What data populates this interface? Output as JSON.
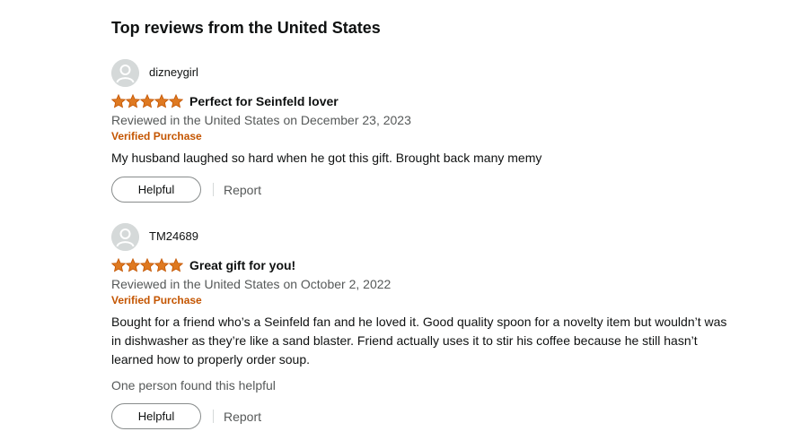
{
  "section": {
    "title": "Top reviews from the United States"
  },
  "colors": {
    "star": "#de7921",
    "verified": "#c45500",
    "muted_text": "#565959"
  },
  "reviews": [
    {
      "profile_name": "dizneygirl",
      "rating": 5,
      "rating_max": 5,
      "title": "Perfect for Seinfeld lover",
      "date_line": "Reviewed in the United States on December 23, 2023",
      "verified_label": "Verified Purchase",
      "body": "My husband laughed so hard when he got this gift. Brought back many memy",
      "helpful_count_text": "",
      "helpful_label": "Helpful",
      "report_label": "Report"
    },
    {
      "profile_name": "TM24689",
      "rating": 5,
      "rating_max": 5,
      "title": "Great gift for you!",
      "date_line": "Reviewed in the United States on October 2, 2022",
      "verified_label": "Verified Purchase",
      "body": "Bought for a friend who’s a Seinfeld fan and he loved it. Good quality spoon for a novelty item but wouldn’t was in dishwasher as they’re like a sand blaster. Friend actually uses it to stir his coffee because he still hasn’t learned how to properly order soup.",
      "helpful_count_text": "One person found this helpful",
      "helpful_label": "Helpful",
      "report_label": "Report"
    }
  ],
  "icons": {
    "avatar": "user-avatar-icon",
    "star": "star-icon"
  }
}
